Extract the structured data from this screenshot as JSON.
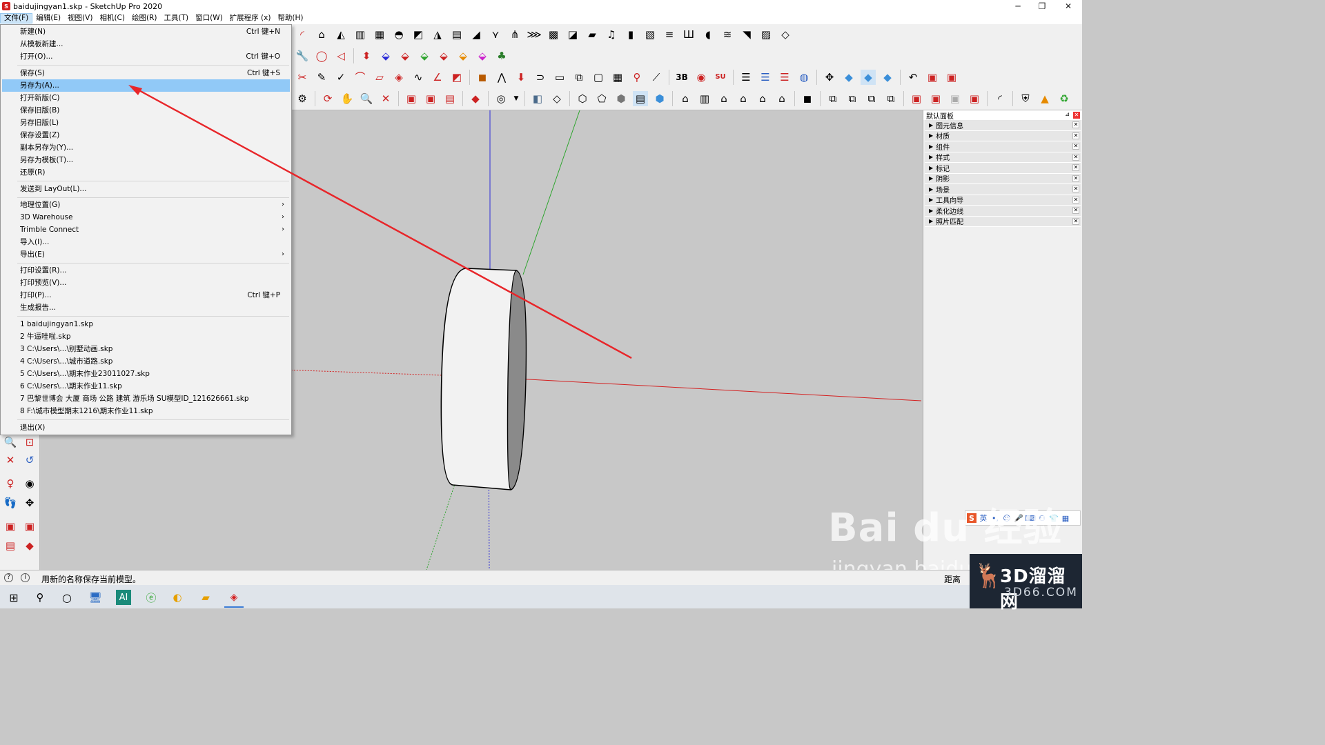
{
  "window": {
    "title": "baidujingyan1.skp - SketchUp Pro 2020",
    "minimize": "─",
    "restore": "❐",
    "close": "✕"
  },
  "menubar": {
    "items": [
      "文件(F)",
      "编辑(E)",
      "视图(V)",
      "相机(C)",
      "绘图(R)",
      "工具(T)",
      "窗口(W)",
      "扩展程序 (x)",
      "帮助(H)"
    ]
  },
  "file_menu": {
    "new": {
      "label": "新建(N)",
      "shortcut": "Ctrl 键+N"
    },
    "new_from_template": {
      "label": "从模板新建..."
    },
    "open": {
      "label": "打开(O)...",
      "shortcut": "Ctrl 键+O"
    },
    "save": {
      "label": "保存(S)",
      "shortcut": "Ctrl 键+S"
    },
    "save_as": {
      "label": "另存为(A)..."
    },
    "open_new_version": {
      "label": "打开新版(C)"
    },
    "save_old_version": {
      "label": "保存旧版(B)"
    },
    "save_as_old_version": {
      "label": "另存旧版(L)"
    },
    "save_settings": {
      "label": "保存设置(Z)"
    },
    "save_copy_as": {
      "label": "副本另存为(Y)..."
    },
    "save_as_template": {
      "label": "另存为模板(T)..."
    },
    "revert": {
      "label": "还原(R)"
    },
    "send_to_layout": {
      "label": "发送到 LayOut(L)..."
    },
    "geo_location": {
      "label": "地理位置(G)"
    },
    "warehouse": {
      "label": "3D Warehouse"
    },
    "trimble_connect": {
      "label": "Trimble Connect"
    },
    "import": {
      "label": "导入(I)..."
    },
    "export": {
      "label": "导出(E)"
    },
    "print_setup": {
      "label": "打印设置(R)..."
    },
    "print_preview": {
      "label": "打印预览(V)..."
    },
    "print": {
      "label": "打印(P)...",
      "shortcut": "Ctrl 键+P"
    },
    "generate_report": {
      "label": "生成报告..."
    },
    "recent": [
      "1 baidujingyan1.skp",
      "2 牛逼哇啦.skp",
      "3 C:\\Users\\...\\别墅动画.skp",
      "4 C:\\Users\\...\\城市道路.skp",
      "5 C:\\Users\\...\\期末作业23011027.skp",
      "6 C:\\Users\\...\\期末作业11.skp",
      "7 巴黎世博会 大厦 商场 公路 建筑 游乐场 SU模型ID_121626661.skp",
      "8 F:\\城市模型期末1216\\期末作业11.skp"
    ],
    "exit": {
      "label": "退出(X)"
    }
  },
  "tray": {
    "title": "默认面板",
    "panels": [
      "图元信息",
      "材质",
      "组件",
      "样式",
      "标记",
      "阴影",
      "场景",
      "工具向导",
      "柔化边线",
      "照片匹配"
    ]
  },
  "statusbar": {
    "message": "用新的名称保存当前模型。",
    "measurement_label": "距离"
  },
  "ime": {
    "lang": "英"
  },
  "watermark": {
    "main": "Bai du 经验",
    "sub": "jingyan.baidu"
  },
  "logo": {
    "main": "3D溜溜网",
    "sub": "3D66.COM"
  },
  "colors": {
    "highlight": "#91c9f7",
    "red_axis": "#d42020",
    "green_axis": "#2fa52f",
    "blue_axis": "#2b2bd8",
    "arrow": "#e8262a"
  }
}
